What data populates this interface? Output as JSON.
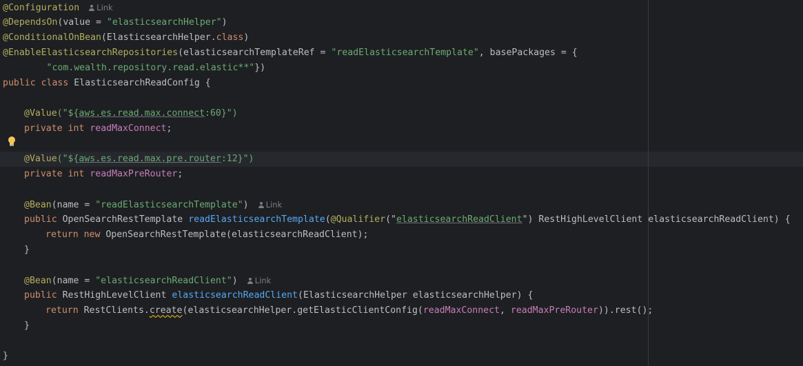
{
  "editor": {
    "hints": {
      "link": "Link"
    },
    "lines": {
      "l1": {
        "annotation": "@Configuration"
      },
      "l2": {
        "annotation": "@DependsOn",
        "open": "(value = ",
        "value": "\"elasticsearchHelper\"",
        "close": ")"
      },
      "l3": {
        "annotation": "@ConditionalOnBean",
        "open": "(ElasticsearchHelper.",
        "kw": "class",
        "close": ")"
      },
      "l4": {
        "annotation": "@EnableElasticsearchRepositories",
        "open": "(elasticsearchTemplateRef = ",
        "value": "\"readElasticsearchTemplate\"",
        "rest": ", basePackages = {"
      },
      "l5": {
        "indent": "        ",
        "value": "\"com.wealth.repository.read.elastic**\"",
        "close": "})"
      },
      "l6": {
        "kw1": "public",
        "kw2": "class",
        "name": " ElasticsearchReadConfig {"
      },
      "l8": {
        "annotation": "@Value",
        "open": "(\"${",
        "prop": "aws.es.read.max.connect",
        "default": ":60}",
        "close": "\")"
      },
      "l9": {
        "kw1": "private",
        "kw2": "int",
        "field": "readMaxConnect",
        "end": ";"
      },
      "l11": {
        "annotation": "@Value",
        "open": "(\"${",
        "prop": "aws.es.read.max.pre.router",
        "default": ":12}",
        "close": "\")"
      },
      "l12": {
        "kw1": "private",
        "kw2": "int",
        "field": "readMaxPreRouter",
        "end": ";"
      },
      "l14": {
        "annotation": "@Bean",
        "open": "(name = ",
        "value": "\"readElasticsearchTemplate\"",
        "close": ")"
      },
      "l15": {
        "kw": "public",
        "type": " OpenSearchRestTemplate ",
        "method": "readElasticsearchTemplate",
        "open": "(",
        "annotation": "@Qualifier",
        "q_open": "(\"",
        "q_value": "elasticsearchReadClient",
        "q_close": "\")",
        "rest": " RestHighLevelClient elasticsearchReadClient) {"
      },
      "l16": {
        "kw1": "return",
        "kw2": "new",
        "rest": " OpenSearchRestTemplate(elasticsearchReadClient);"
      },
      "l17": {
        "text": "}"
      },
      "l19": {
        "annotation": "@Bean",
        "open": "(name = ",
        "value": "\"elasticsearchReadClient\"",
        "close": ")"
      },
      "l20": {
        "kw": "public",
        "type": " RestHighLevelClient ",
        "method": "elasticsearchReadClient",
        "rest": "(ElasticsearchHelper elasticsearchHelper) {"
      },
      "l21": {
        "kw": "return",
        "pre": " RestClients.",
        "call": "create",
        "mid": "(elasticsearchHelper.getElasticClientConfig(",
        "field1": "readMaxConnect",
        "sep": ", ",
        "field2": "readMaxPreRouter",
        "end": ")).rest();"
      },
      "l22": {
        "text": "}"
      },
      "l24": {
        "text": "}"
      }
    }
  }
}
